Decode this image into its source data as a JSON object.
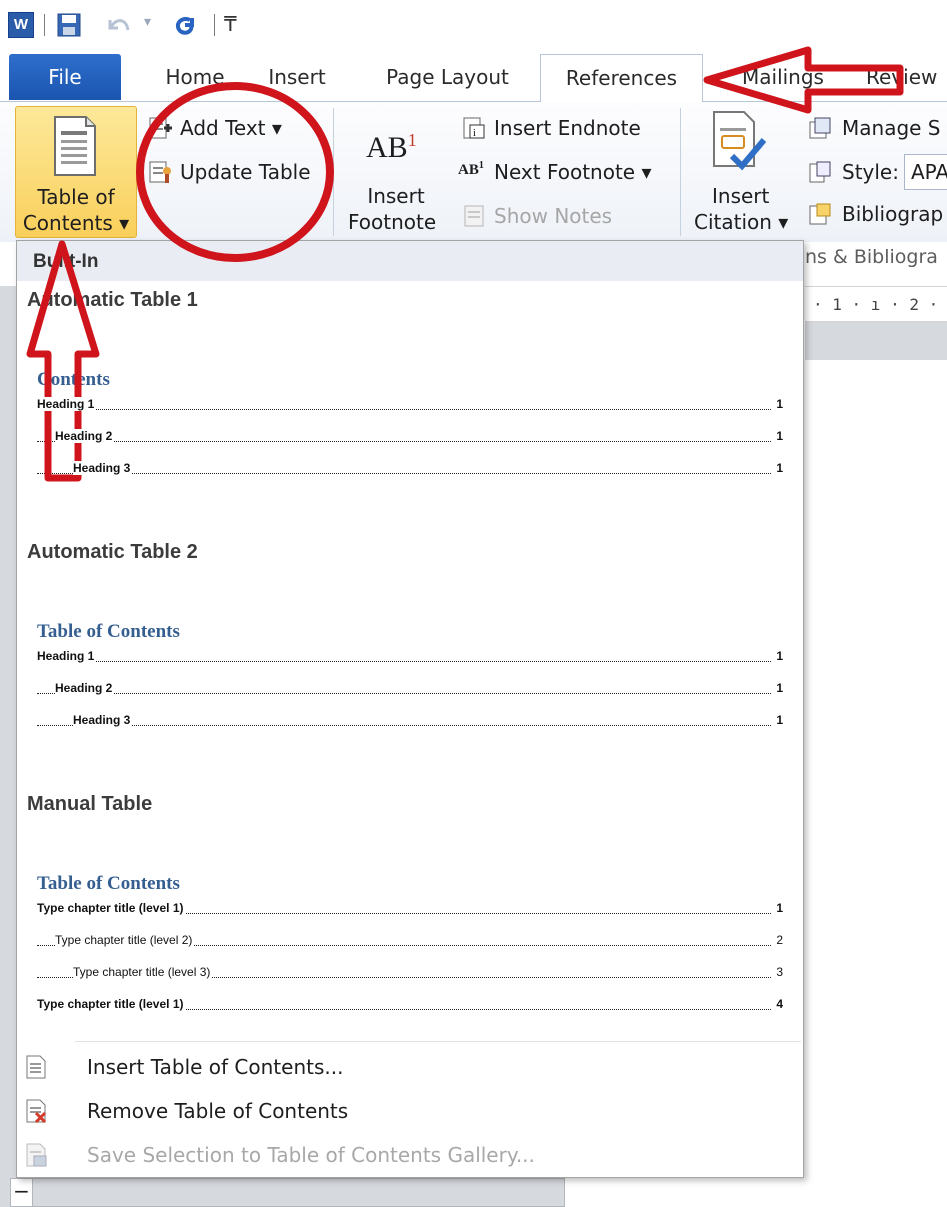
{
  "app_logo": "W",
  "tabs": {
    "file": "File",
    "home": "Home",
    "insert": "Insert",
    "page_layout": "Page Layout",
    "references": "References",
    "mailings": "Mailings",
    "review": "Review"
  },
  "ribbon": {
    "toc_label_line1": "Table of",
    "toc_label_line2": "Contents ▾",
    "add_text": "Add Text ▾",
    "update_table": "Update Table",
    "insert_footnote_line1": "Insert",
    "insert_footnote_line2": "Footnote",
    "insert_endnote": "Insert Endnote",
    "next_footnote": "Next Footnote ▾",
    "show_notes": "Show Notes",
    "insert_citation_line1": "Insert",
    "insert_citation_line2": "Citation ▾",
    "manage_sources": "Manage S",
    "style_label": "Style:",
    "style_value": "APA",
    "bibliography": "Bibliograp",
    "citations_group_label": "ns & Bibliogra"
  },
  "ruler_text": "· 1 · ı · 2 ·",
  "dropdown": {
    "builtin_header": "Built-In",
    "gallery": [
      {
        "title": "Automatic Table 1",
        "heading": "Contents",
        "entries": [
          {
            "text": "Heading 1",
            "page": "1"
          },
          {
            "text": "Heading 2",
            "page": "1"
          },
          {
            "text": "Heading 3",
            "page": "1"
          }
        ]
      },
      {
        "title": "Automatic Table 2",
        "heading": "Table of Contents",
        "entries": [
          {
            "text": "Heading 1",
            "page": "1"
          },
          {
            "text": "Heading 2",
            "page": "1"
          },
          {
            "text": "Heading 3",
            "page": "1"
          }
        ]
      },
      {
        "title": "Manual Table",
        "heading": "Table of Contents",
        "entries": [
          {
            "text": "Type chapter title (level 1)",
            "page": "1"
          },
          {
            "text": "Type chapter title (level 2)",
            "page": "2"
          },
          {
            "text": "Type chapter title (level 3)",
            "page": "3"
          },
          {
            "text": "Type chapter title (level 1)",
            "page": "4"
          }
        ]
      }
    ],
    "menu": {
      "insert_toc": "Insert Table of Contents...",
      "remove_toc": "Remove Table of Contents",
      "save_selection": "Save Selection to Table of Contents Gallery..."
    }
  },
  "colors": {
    "file_tab": "#1a55b0",
    "toc_button": "#f9cf5b",
    "preview_heading": "#365f91",
    "annotation_red": "#d0141c"
  }
}
